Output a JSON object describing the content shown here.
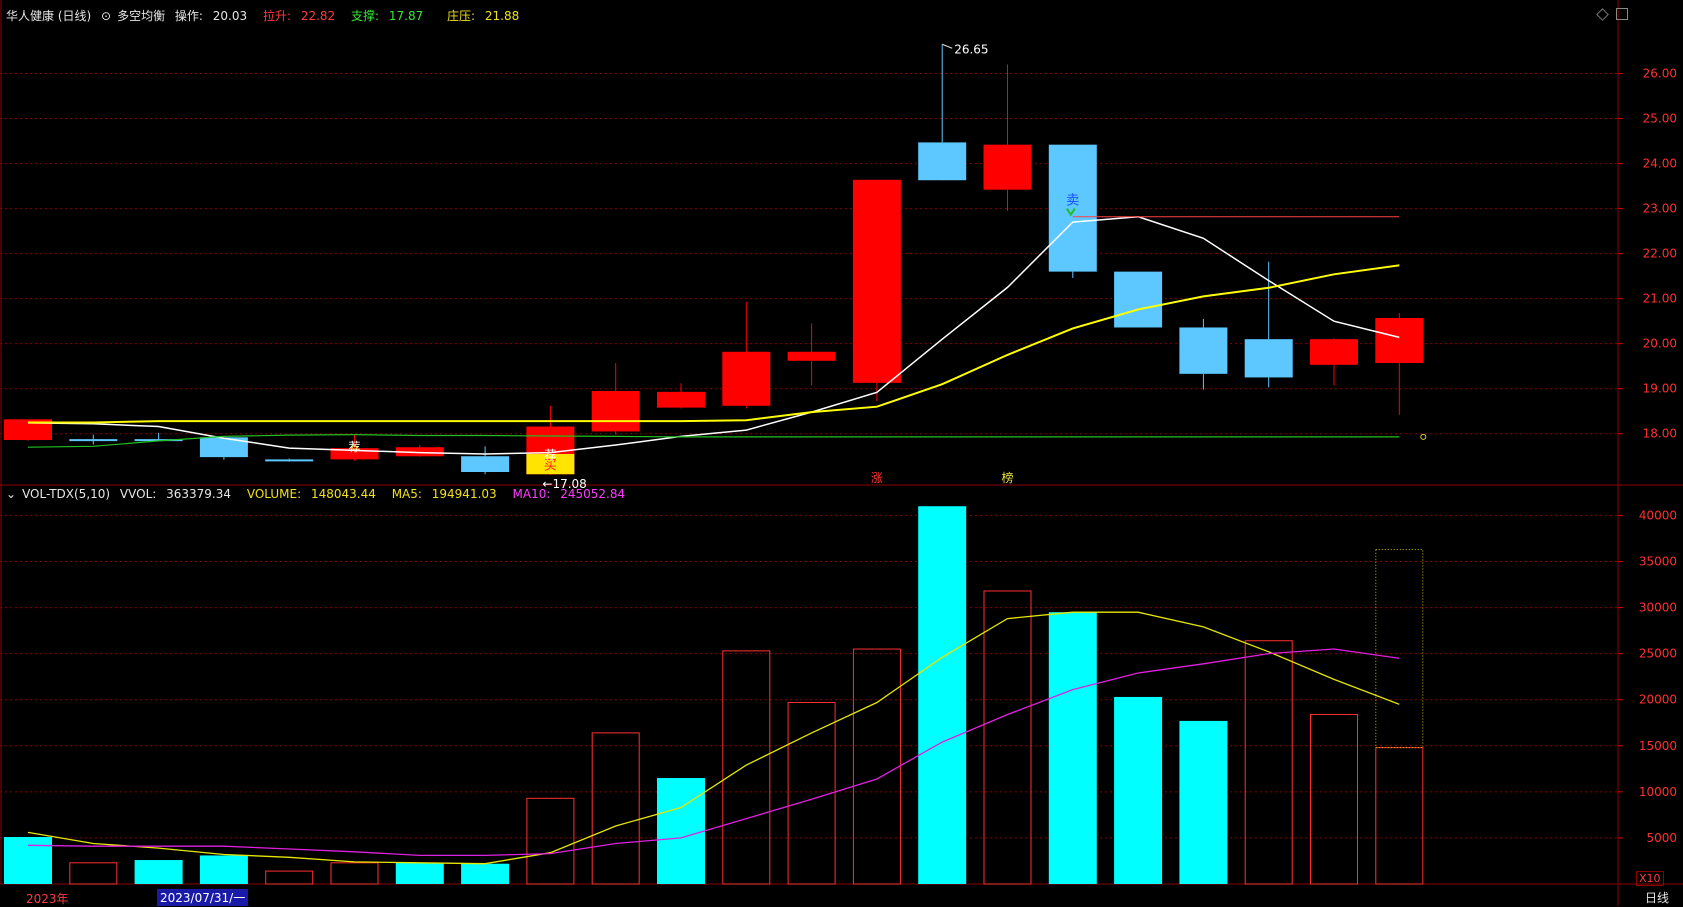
{
  "header": {
    "stock_name": "华人健康 (日线)",
    "indicator": "多空均衡",
    "operate_label": "操作: ",
    "operate_value": "20.03",
    "pull_label": "拉升: ",
    "pull_value": "22.82",
    "support_label": "支撑: ",
    "support_value": "17.87",
    "pressure_label": "庄压: ",
    "pressure_value": "21.88"
  },
  "volume_header": {
    "name": "VOL-TDX(5,10)",
    "vvol_label": "VVOL: ",
    "vvol_value": "363379.34",
    "volume_label": "VOLUME: ",
    "volume_value": "148043.44",
    "ma5_label": "MA5: ",
    "ma5_value": "194941.03",
    "ma10_label": "MA10: ",
    "ma10_value": "245052.84"
  },
  "bottom": {
    "year": "2023年",
    "date_cursor": "2023/07/31/一",
    "period": "日线",
    "scale": "X10"
  },
  "colors": {
    "up": "#ff0000",
    "down": "#5cc8ff",
    "vol_down": "#00ffff",
    "grid": "#8b0000",
    "ma_white": "#ffffff",
    "ma_yellow": "#ffff00",
    "ma_green": "#20c020",
    "vol_ma5": "#e6e600",
    "vol_ma10": "#e020e0"
  },
  "chart_data": [
    {
      "type": "candlestick",
      "yticks": [
        "26.00",
        "25.00",
        "24.00",
        "23.00",
        "22.00",
        "21.00",
        "20.00",
        "19.00",
        "18.00"
      ],
      "ylim": [
        16.95,
        27.1
      ],
      "candles": [
        {
          "o": 17.86,
          "h": 18.32,
          "l": 17.84,
          "c": 18.32
        },
        {
          "o": 17.88,
          "h": 17.98,
          "l": 17.76,
          "c": 17.86
        },
        {
          "o": 17.88,
          "h": 18.02,
          "l": 17.84,
          "c": 17.86
        },
        {
          "o": 17.92,
          "h": 17.92,
          "l": 17.42,
          "c": 17.48
        },
        {
          "o": 17.43,
          "h": 17.45,
          "l": 17.38,
          "c": 17.4
        },
        {
          "o": 17.43,
          "h": 17.98,
          "l": 17.4,
          "c": 17.68
        },
        {
          "o": 17.5,
          "h": 17.75,
          "l": 17.48,
          "c": 17.7
        },
        {
          "o": 17.5,
          "h": 17.72,
          "l": 17.1,
          "c": 17.15
        },
        {
          "o": 17.1,
          "h": 18.62,
          "l": 17.08,
          "c": 18.16
        },
        {
          "o": 18.05,
          "h": 19.57,
          "l": 17.98,
          "c": 18.95
        },
        {
          "o": 18.58,
          "h": 19.12,
          "l": 18.56,
          "c": 18.93
        },
        {
          "o": 18.62,
          "h": 20.93,
          "l": 18.56,
          "c": 19.82
        },
        {
          "o": 19.62,
          "h": 20.45,
          "l": 19.08,
          "c": 19.82
        },
        {
          "o": 19.13,
          "h": 23.64,
          "l": 18.72,
          "c": 23.64
        },
        {
          "o": 24.47,
          "h": 26.65,
          "l": 23.78,
          "c": 23.63
        },
        {
          "o": 23.42,
          "h": 26.2,
          "l": 22.95,
          "c": 24.42
        },
        {
          "o": 24.42,
          "h": 24.42,
          "l": 21.46,
          "c": 21.6
        },
        {
          "o": 21.6,
          "h": 21.6,
          "l": 20.36,
          "c": 20.36
        },
        {
          "o": 20.36,
          "h": 20.55,
          "l": 18.98,
          "c": 19.33
        },
        {
          "o": 20.1,
          "h": 21.82,
          "l": 19.03,
          "c": 19.25
        },
        {
          "o": 19.53,
          "h": 20.12,
          "l": 19.07,
          "c": 20.1
        },
        {
          "o": 19.57,
          "h": 20.68,
          "l": 18.42,
          "c": 20.57
        }
      ],
      "ma_white": [
        18.24,
        18.22,
        18.16,
        17.9,
        17.68,
        17.63,
        17.58,
        17.55,
        17.58,
        17.75,
        17.94,
        18.08,
        18.48,
        18.92,
        20.1,
        21.25,
        22.7,
        22.82,
        22.34,
        21.4,
        20.5,
        20.14
      ],
      "ma_yellow": [
        18.25,
        18.25,
        18.28,
        18.28,
        18.28,
        18.28,
        18.28,
        18.28,
        18.28,
        18.28,
        18.28,
        18.3,
        18.48,
        18.6,
        19.1,
        19.75,
        20.34,
        20.76,
        21.05,
        21.24,
        21.54,
        21.74,
        21.88
      ],
      "ma_green": [
        17.7,
        17.72,
        17.84,
        17.94,
        17.97,
        17.98,
        17.96,
        17.96,
        17.95,
        17.94,
        17.93,
        17.93,
        17.93,
        17.93,
        17.93,
        17.93,
        17.93,
        17.93,
        17.93,
        17.93,
        17.93,
        17.93,
        17.93,
        17.98,
        18.02,
        18.15
      ],
      "annotations": {
        "high_label": "26.65",
        "low_label": "17.08",
        "buy_mark": "买",
        "sell_mark": "卖",
        "rec_mark": "荐",
        "zhang_mark": "涨",
        "bang_mark": "榜",
        "pull_value": 22.82
      }
    },
    {
      "type": "bar",
      "yticks": [
        "40000",
        "35000",
        "30000",
        "25000",
        "20000",
        "15000",
        "10000",
        "5000"
      ],
      "ylim": [
        0,
        42000
      ],
      "values": [
        5100,
        2300,
        2600,
        3100,
        1400,
        2300,
        2300,
        2200,
        9300,
        16400,
        11500,
        25300,
        19700,
        25500,
        41000,
        31800,
        29500,
        20300,
        17700,
        26400,
        18400,
        14800
      ],
      "up": [
        false,
        true,
        false,
        false,
        true,
        true,
        false,
        false,
        true,
        true,
        false,
        true,
        true,
        true,
        false,
        true,
        false,
        false,
        false,
        true,
        true,
        true
      ],
      "ma5": [
        5600,
        4400,
        3900,
        3200,
        2900,
        2400,
        2300,
        2200,
        3400,
        6300,
        8300,
        12900,
        16400,
        19700,
        24600,
        28800,
        29500,
        29500,
        27900,
        25200,
        22200,
        19500
      ],
      "ma10": [
        4200,
        4100,
        4100,
        4100,
        3800,
        3500,
        3100,
        3100,
        3300,
        4400,
        5000,
        7100,
        9200,
        11400,
        15400,
        18400,
        21100,
        22900,
        23900,
        25000,
        25500,
        24500
      ],
      "last_ghost_value": 36300
    }
  ]
}
